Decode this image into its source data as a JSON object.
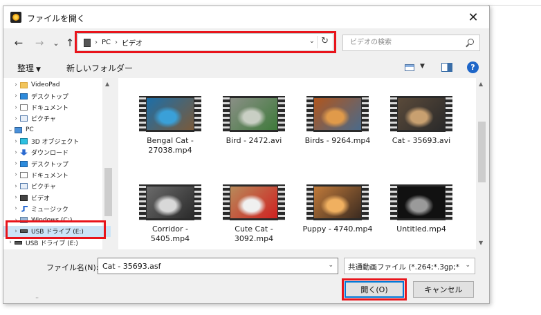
{
  "window": {
    "title": "ファイルを開く",
    "close_glyph": "✕"
  },
  "nav": {
    "back": "←",
    "forward": "→",
    "recent": "⌄",
    "up": "↑"
  },
  "address": {
    "crumbs": [
      "PC",
      "ビデオ"
    ],
    "separator": "›",
    "dropdown": "⌄",
    "refresh": "↻"
  },
  "search": {
    "placeholder": "ビデオの検索"
  },
  "toolbar": {
    "organize": "整理",
    "organize_caret": "▼",
    "new_folder": "新しいフォルダー",
    "help": "?"
  },
  "tree": [
    {
      "label": "VideoPad",
      "icon": "folder",
      "arrow": "›",
      "indent": 1
    },
    {
      "label": "デスクトップ",
      "icon": "desktop",
      "arrow": "›",
      "indent": 1
    },
    {
      "label": "ドキュメント",
      "icon": "doc",
      "arrow": "›",
      "indent": 1
    },
    {
      "label": "ピクチャ",
      "icon": "pic",
      "arrow": "›",
      "indent": 1
    },
    {
      "label": "PC",
      "icon": "pc",
      "arrow": "⌄",
      "indent": 0
    },
    {
      "label": "3D オブジェクト",
      "icon": "3d",
      "arrow": "›",
      "indent": 1
    },
    {
      "label": "ダウンロード",
      "icon": "down",
      "arrow": "›",
      "indent": 1
    },
    {
      "label": "デスクトップ",
      "icon": "desktop",
      "arrow": "›",
      "indent": 1
    },
    {
      "label": "ドキュメント",
      "icon": "doc",
      "arrow": "›",
      "indent": 1
    },
    {
      "label": "ピクチャ",
      "icon": "pic",
      "arrow": "›",
      "indent": 1
    },
    {
      "label": "ビデオ",
      "icon": "video",
      "arrow": "›",
      "indent": 1
    },
    {
      "label": "ミュージック",
      "icon": "music",
      "arrow": "›",
      "indent": 1
    },
    {
      "label": "Windows (C:)",
      "icon": "win",
      "arrow": "›",
      "indent": 1
    },
    {
      "label": "USB ドライブ (E:)",
      "icon": "usb",
      "arrow": "›",
      "indent": 1,
      "selected": true
    },
    {
      "label": "USB ドライブ (E:)",
      "icon": "usb",
      "arrow": "›",
      "indent": 0
    }
  ],
  "files": [
    {
      "name": "Bengal Cat - 27038.mp4",
      "colors": [
        "#1d6fa8",
        "#3aa0d8",
        "#7a5a3a"
      ]
    },
    {
      "name": "Bird - 2472.avi",
      "colors": [
        "#8a8f86",
        "#c9cfc4",
        "#3e7a3a"
      ]
    },
    {
      "name": "Birds - 9264.mp4",
      "colors": [
        "#b0561e",
        "#e09a4a",
        "#4a6a8a"
      ]
    },
    {
      "name": "Cat - 35693.avi",
      "colors": [
        "#5a4a3a",
        "#c8a070",
        "#2a2a2a"
      ]
    },
    {
      "name": "Corridor - 5405.mp4",
      "colors": [
        "#6a6a6a",
        "#d8d8d8",
        "#2a2a2a"
      ]
    },
    {
      "name": "Cute Cat - 3092.mp4",
      "colors": [
        "#b88a5a",
        "#f0f0f0",
        "#d02020"
      ]
    },
    {
      "name": "Puppy - 4740.mp4",
      "colors": [
        "#c07a3a",
        "#f0b060",
        "#3a2a20"
      ]
    },
    {
      "name": "Untitled.mp4",
      "colors": [
        "#111111",
        "#9a9a9a",
        "#111111"
      ]
    }
  ],
  "bottom": {
    "filename_label": "ファイル名(N):",
    "filename_value": "Cat - 35693.asf",
    "filetype": "共通動画ファイル (*.264;*.3gp;*.a",
    "caret": "⌄",
    "open": "開く(O)",
    "cancel": "キャンセル"
  },
  "colors": {
    "highlight": "#e8141b",
    "accent": "#0078d7"
  }
}
